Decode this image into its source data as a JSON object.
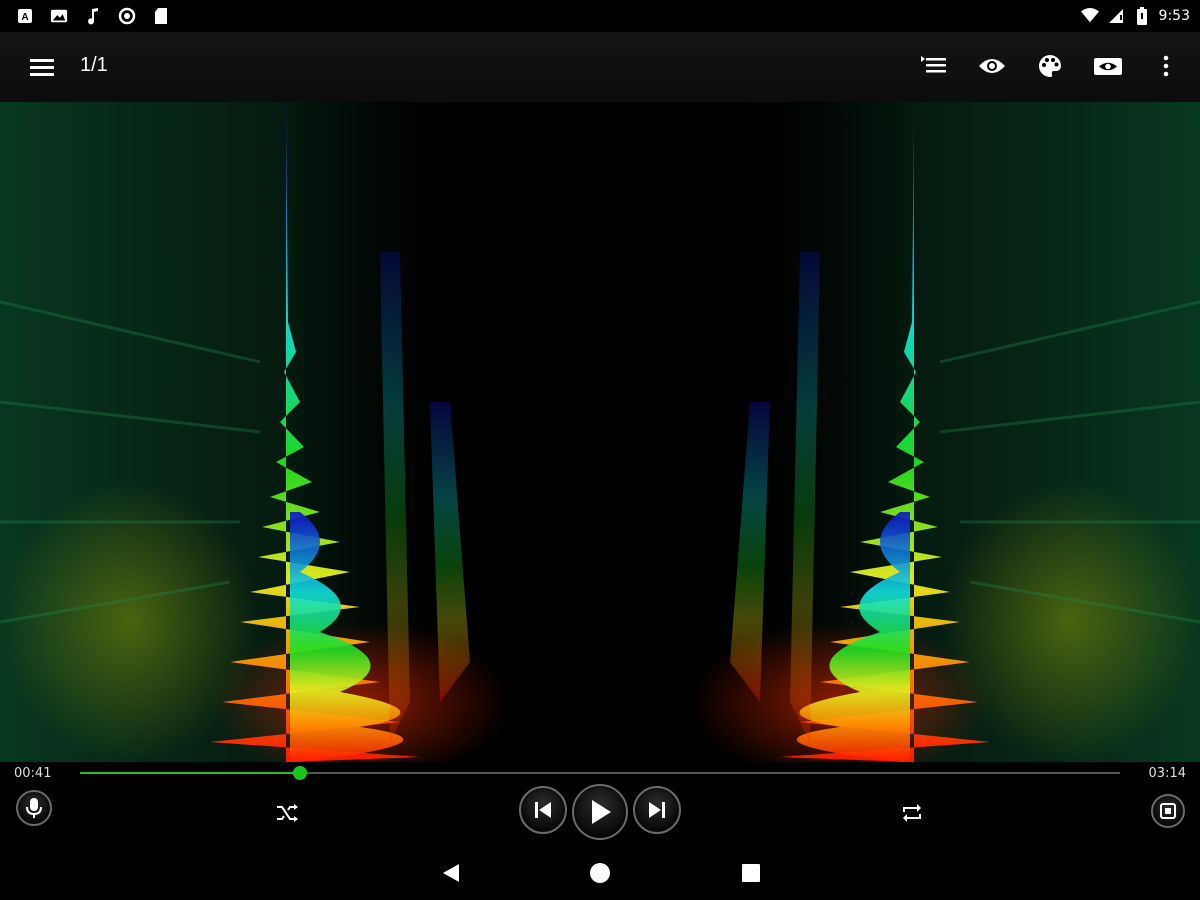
{
  "status_bar": {
    "time": "9:53",
    "left_icons": [
      "a-box-icon",
      "image-icon",
      "music-note-icon",
      "circle-icon",
      "sd-card-icon"
    ],
    "right_icons": [
      "wifi-icon",
      "signal-icon",
      "battery-icon"
    ]
  },
  "toolbar": {
    "title": "1/1",
    "actions": [
      "playlist-icon",
      "eye-icon",
      "palette-icon",
      "camera-eye-icon",
      "more-vert-icon"
    ]
  },
  "player": {
    "elapsed": "00:41",
    "total": "03:14",
    "progress": 0.212,
    "accent": "#1bc41b"
  },
  "controls": [
    "mic-icon",
    "shuffle-icon",
    "previous-icon",
    "play-icon",
    "next-icon",
    "repeat-icon",
    "stop-icon"
  ],
  "navigation": [
    "back-icon",
    "home-icon",
    "recents-icon"
  ]
}
